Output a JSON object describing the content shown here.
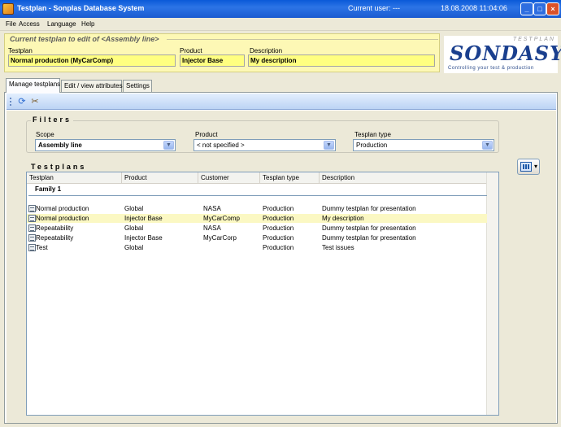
{
  "window": {
    "title": "Testplan - Sonplas Database System",
    "current_user": "Current user: ---",
    "datetime": "18.08.2008 11:04:06",
    "controls": [
      "minimize-icon",
      "maximize-icon",
      "close-icon"
    ]
  },
  "menu": [
    "File",
    "Access",
    "Language",
    "Help"
  ],
  "context": {
    "legend": "Current testplan to edit of <Assembly line>",
    "testplan_label": "Testplan",
    "testplan_value": "Normal production (MyCarComp)",
    "product_label": "Product",
    "product_value": "Injector Base",
    "description_label": "Description",
    "description_value": "My description"
  },
  "logo": {
    "top": "TESTPLAN",
    "main": "SONDASYS",
    "tagline": "Controlling your test & production"
  },
  "tabs": [
    "Manage testplans",
    "Edit / view attributes",
    "Settings"
  ],
  "toolbar": {
    "icons": [
      "refresh-icon",
      "tools-icon"
    ]
  },
  "filters": {
    "title": "Filters",
    "scope_label": "Scope",
    "scope_value": "Assembly line",
    "product_label": "Product",
    "product_value": "< not specified >",
    "type_label": "Tesplan type",
    "type_value": "Production"
  },
  "testplans": {
    "title": "Testplans",
    "columns": [
      "Testplan",
      "Product",
      "Customer",
      "Tesplan type",
      "Description"
    ],
    "group": "Family 1",
    "rows": [
      {
        "testplan": "Normal production",
        "product": "Global",
        "customer": "NASA",
        "type": "Production",
        "description": "Dummy testplan for presentation"
      },
      {
        "testplan": "Normal production",
        "product": "Injector Base",
        "customer": "MyCarComp",
        "type": "Production",
        "description": "My description"
      },
      {
        "testplan": "Repeatability",
        "product": "Global",
        "customer": "NASA",
        "type": "Production",
        "description": "Dummy testplan for presentation"
      },
      {
        "testplan": "Repeatability",
        "product": "Injector Base",
        "customer": "MyCarCorp",
        "type": "Production",
        "description": "Dummy testplan for presentation"
      },
      {
        "testplan": "Test",
        "product": "Global",
        "customer": "",
        "type": "Production",
        "description": "Test issues"
      }
    ],
    "selected_row": 1
  },
  "colors": {
    "titlebar": "#1b5bd0",
    "context_panel": "#fdf8b5",
    "context_field": "#ffff80",
    "selected_row": "#fbf8c3",
    "logo_text": "#1a3f8e"
  }
}
